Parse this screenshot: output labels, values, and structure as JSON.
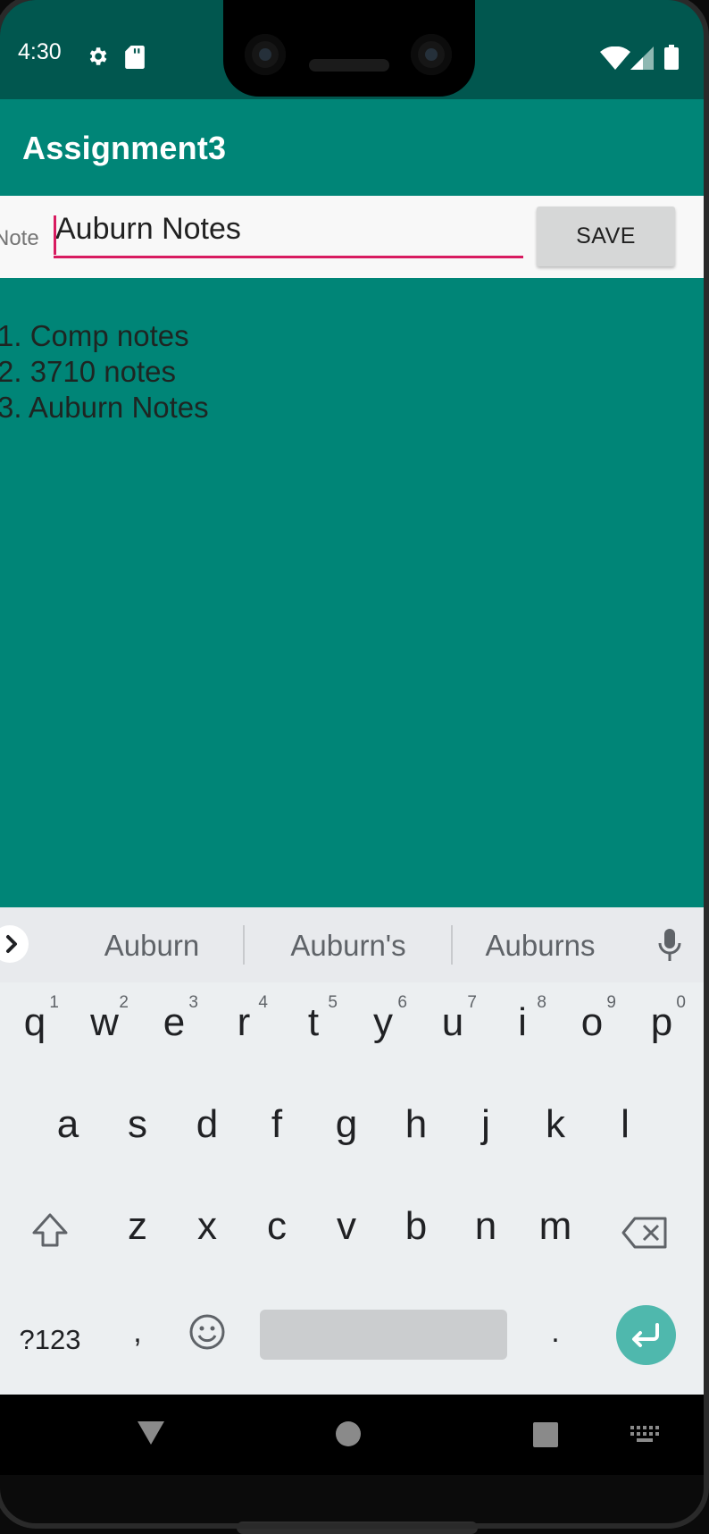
{
  "status_bar": {
    "time": "4:30",
    "icons": [
      "gear-icon",
      "sdcard-icon",
      "wifi-icon",
      "signal-icon",
      "battery-icon"
    ]
  },
  "app_bar": {
    "title": "Assignment3",
    "color": "#008577"
  },
  "note_form": {
    "label": "Note",
    "input_value": "Auburn Notes",
    "save_label": "SAVE",
    "accent_color": "#d81b60"
  },
  "notes": [
    "1. Comp notes",
    "2. 3710 notes",
    "3. Auburn Notes"
  ],
  "keyboard": {
    "suggestions": [
      "Auburn",
      "Auburn's",
      "Auburns"
    ],
    "row1": [
      {
        "key": "q",
        "hint": "1"
      },
      {
        "key": "w",
        "hint": "2"
      },
      {
        "key": "e",
        "hint": "3"
      },
      {
        "key": "r",
        "hint": "4"
      },
      {
        "key": "t",
        "hint": "5"
      },
      {
        "key": "y",
        "hint": "6"
      },
      {
        "key": "u",
        "hint": "7"
      },
      {
        "key": "i",
        "hint": "8"
      },
      {
        "key": "o",
        "hint": "9"
      },
      {
        "key": "p",
        "hint": "0"
      }
    ],
    "row2": [
      "a",
      "s",
      "d",
      "f",
      "g",
      "h",
      "j",
      "k",
      "l"
    ],
    "row3": [
      "z",
      "x",
      "c",
      "v",
      "b",
      "n",
      "m"
    ],
    "symbols_label": "?123",
    "comma": ",",
    "period": ".",
    "icons": [
      "expand-suggestions-icon",
      "mic-icon",
      "shift-icon",
      "backspace-icon",
      "emoji-icon",
      "enter-icon"
    ]
  },
  "nav_bar": {
    "icons": [
      "back-icon",
      "home-icon",
      "recents-icon",
      "keyboard-switch-icon"
    ]
  }
}
